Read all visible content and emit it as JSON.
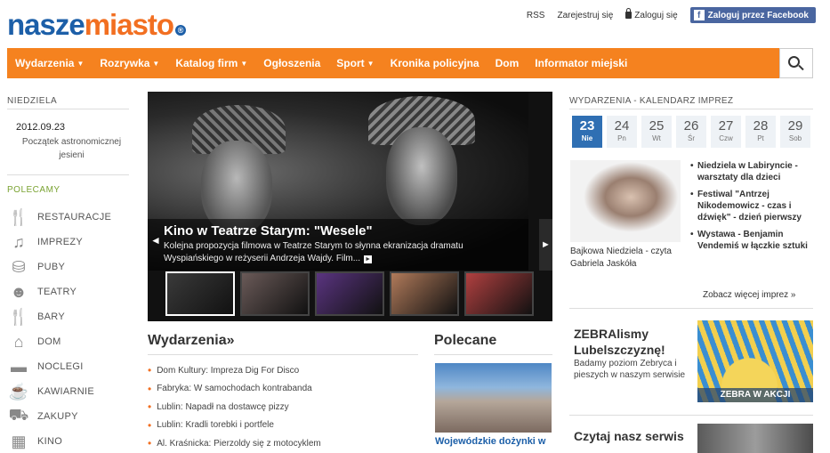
{
  "logo": {
    "part1": "nasze",
    "part2": "miasto",
    "suffix": "®"
  },
  "toplinks": {
    "rss": "RSS",
    "homepage": "Zarejestruj się",
    "login": "Zaloguj się",
    "facebook": "Zaloguj przez Facebook"
  },
  "nav": [
    {
      "label": "Wydarzenia",
      "has_dropdown": true
    },
    {
      "label": "Rozrywka",
      "has_dropdown": true
    },
    {
      "label": "Katalog firm",
      "has_dropdown": true
    },
    {
      "label": "Ogłoszenia",
      "has_dropdown": false
    },
    {
      "label": "Sport",
      "has_dropdown": true
    },
    {
      "label": "Kronika policyjna",
      "has_dropdown": false
    },
    {
      "label": "Dom",
      "has_dropdown": false
    },
    {
      "label": "Informator miejski",
      "has_dropdown": false
    }
  ],
  "left": {
    "day_label": "NIEDZIELA",
    "date": "2012.09.23",
    "date_note": "Początek astronomicznej jesieni",
    "recommend_label": "POLECAMY",
    "categories": [
      {
        "label": "RESTAURACJE",
        "icon": "cutlery-icon"
      },
      {
        "label": "IMPREZY",
        "icon": "music-note-icon"
      },
      {
        "label": "PUBY",
        "icon": "glass-icon"
      },
      {
        "label": "TEATRY",
        "icon": "masks-icon"
      },
      {
        "label": "BARY",
        "icon": "cutlery-icon"
      },
      {
        "label": "DOM",
        "icon": "house-icon"
      },
      {
        "label": "NOCLEGI",
        "icon": "bed-icon"
      },
      {
        "label": "KAWIARNIE",
        "icon": "coffee-cup-icon"
      },
      {
        "label": "ZAKUPY",
        "icon": "cart-icon"
      },
      {
        "label": "KINO",
        "icon": "film-icon"
      }
    ]
  },
  "slider": {
    "title": "Kino w Teatrze Starym: \"Wesele\"",
    "desc_line1": "Kolejna propozycja filmowa w Teatrze Starym to słynna ekranizacja dramatu",
    "desc_line2": "Wyspiańskiego w reżyserii Andrzeja Wajdy. Film...",
    "thumb_colors": [
      "#3a3a3a",
      "#6a5a58",
      "#5a3480",
      "#b07a5a",
      "#b04040"
    ]
  },
  "events": {
    "title": "Wydarzenia",
    "title_arrow": "»",
    "items": [
      "Dom Kultury: Impreza Dig For Disco",
      "Fabryka: W samochodach kontrabanda",
      "Lublin: Napadł na dostawcę pizzy",
      "Lublin: Kradli torebki i portfele",
      "Al. Kraśnicka: Pierzoldy się z motocyklem"
    ]
  },
  "polecane": {
    "title": "Polecane",
    "caption": "Wojewódzkie dożynki w"
  },
  "calendar": {
    "label": "WYDARZENIA - KALENDARZ IMPREZ",
    "days": [
      {
        "num": "23",
        "wd": "Nie",
        "today": true
      },
      {
        "num": "24",
        "wd": "Pn",
        "today": false
      },
      {
        "num": "25",
        "wd": "Wt",
        "today": false
      },
      {
        "num": "26",
        "wd": "Śr",
        "today": false
      },
      {
        "num": "27",
        "wd": "Czw",
        "today": false
      },
      {
        "num": "28",
        "wd": "Pt",
        "today": false
      },
      {
        "num": "29",
        "wd": "Sob",
        "today": false
      }
    ]
  },
  "featured_event": {
    "caption": "Bajkowa Niedziela - czyta Gabriela Jaskóła"
  },
  "right_events": [
    "Niedziela w Labiryncie - warsztaty dla dzieci",
    "Festiwal \"Antrzej Nikodemowicz - czas i dźwięk\" - dzień pierwszy",
    "Wystawa - Benjamin Vendemiś w łączkie sztuki"
  ],
  "see_more": "Zobacz więcej imprez »",
  "zebra": {
    "title_line1": "ZEBRAlismy",
    "title_line2": "Lubelszczyznę!",
    "desc": "Badamy poziom Zebryca i pieszych w naszym serwisie",
    "banner_label": "ZEBRA W AKCJI"
  },
  "read": {
    "title": "Czytaj nasz serwis"
  }
}
